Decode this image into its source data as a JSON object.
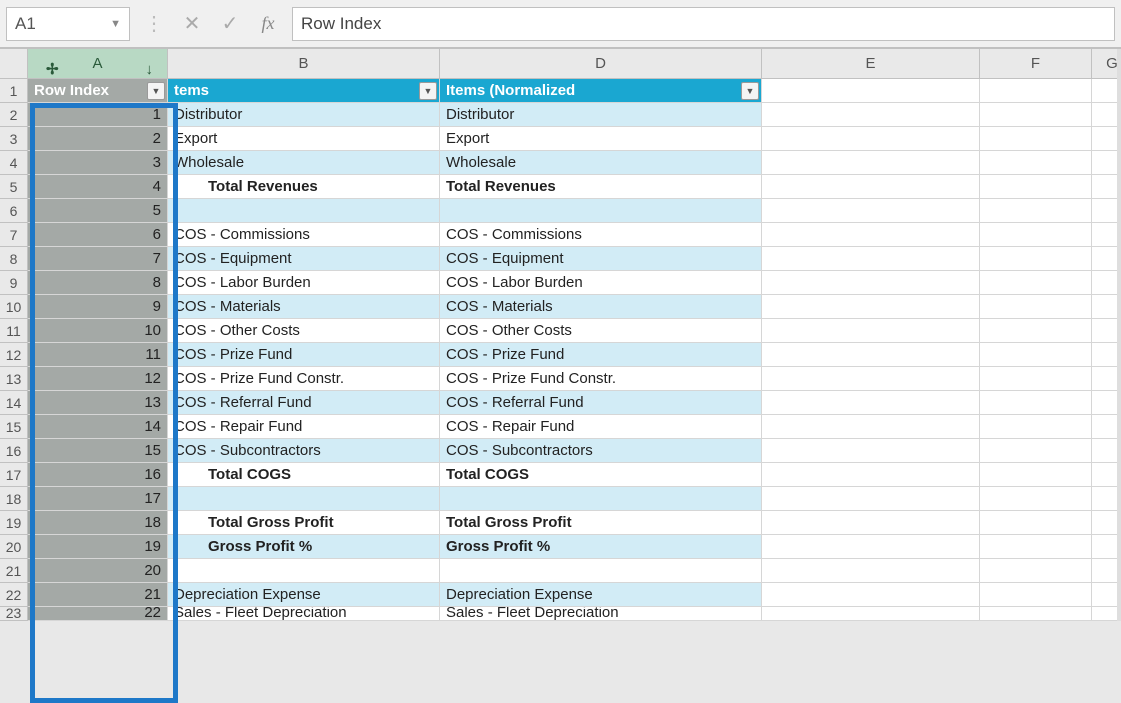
{
  "formula_bar": {
    "name_box": "A1",
    "cancel_glyph": "✕",
    "enter_glyph": "✓",
    "fx_glyph": "fx",
    "menu_glyph": "⋮",
    "formula_value": "Row Index"
  },
  "col_headers": {
    "A": "A",
    "B": "B",
    "D": "D",
    "E": "E",
    "F": "F",
    "G": "G"
  },
  "selected_header_cursors": {
    "left": "✢",
    "right": "↓"
  },
  "table_headers": {
    "A": "Row Index",
    "B": "tems",
    "D": "Items (Normalized"
  },
  "filter_glyph": "▼",
  "rows": [
    {
      "n": 1,
      "header": true
    },
    {
      "n": 2,
      "a": "1",
      "b": "Distributor",
      "d": "Distributor",
      "band": true
    },
    {
      "n": 3,
      "a": "2",
      "b": "Export",
      "d": "Export",
      "band": false
    },
    {
      "n": 4,
      "a": "3",
      "b": "Wholesale",
      "d": "Wholesale",
      "band": true
    },
    {
      "n": 5,
      "a": "4",
      "b": "Total Revenues",
      "d": "Total Revenues",
      "band": false,
      "bold": true,
      "indent": true
    },
    {
      "n": 6,
      "a": "5",
      "b": "",
      "d": "",
      "band": true
    },
    {
      "n": 7,
      "a": "6",
      "b": "COS - Commissions",
      "d": "COS - Commissions",
      "band": false
    },
    {
      "n": 8,
      "a": "7",
      "b": "COS - Equipment",
      "d": "COS - Equipment",
      "band": true
    },
    {
      "n": 9,
      "a": "8",
      "b": "COS - Labor Burden",
      "d": "COS - Labor Burden",
      "band": false
    },
    {
      "n": 10,
      "a": "9",
      "b": "COS - Materials",
      "d": "COS - Materials",
      "band": true
    },
    {
      "n": 11,
      "a": "10",
      "b": "COS - Other Costs",
      "d": "COS - Other Costs",
      "band": false
    },
    {
      "n": 12,
      "a": "11",
      "b": "COS - Prize Fund",
      "d": "COS - Prize Fund",
      "band": true
    },
    {
      "n": 13,
      "a": "12",
      "b": "COS - Prize Fund Constr.",
      "d": "COS - Prize Fund Constr.",
      "band": false
    },
    {
      "n": 14,
      "a": "13",
      "b": "COS - Referral Fund",
      "d": "COS - Referral Fund",
      "band": true
    },
    {
      "n": 15,
      "a": "14",
      "b": "COS - Repair Fund",
      "d": "COS - Repair Fund",
      "band": false
    },
    {
      "n": 16,
      "a": "15",
      "b": "COS - Subcontractors",
      "d": "COS - Subcontractors",
      "band": true
    },
    {
      "n": 17,
      "a": "16",
      "b": "Total COGS",
      "d": "Total COGS",
      "band": false,
      "bold": true,
      "indent": true
    },
    {
      "n": 18,
      "a": "17",
      "b": "",
      "d": "",
      "band": true
    },
    {
      "n": 19,
      "a": "18",
      "b": "Total Gross Profit",
      "d": "Total Gross Profit",
      "band": false,
      "bold": true,
      "indent": true
    },
    {
      "n": 20,
      "a": "19",
      "b": "Gross Profit %",
      "d": "Gross Profit %",
      "band": true,
      "bold": true,
      "indent": true
    },
    {
      "n": 21,
      "a": "20",
      "b": "",
      "d": "",
      "band": false
    },
    {
      "n": 22,
      "a": "21",
      "b": "Depreciation Expense",
      "d": "Depreciation Expense",
      "band": true
    },
    {
      "n": 23,
      "a": "22",
      "b": "Sales - Fleet Depreciation",
      "d": "Sales - Fleet Depreciation",
      "band": false,
      "partial": true
    }
  ]
}
